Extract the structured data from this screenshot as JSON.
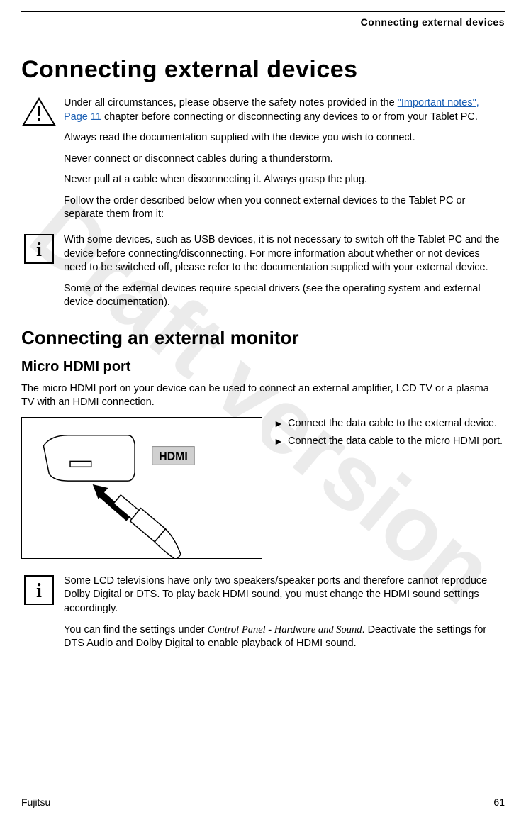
{
  "watermark": "Draft version",
  "header": {
    "running_title": "Connecting external devices"
  },
  "h1": "Connecting external devices",
  "warning": {
    "p1_prefix": "Under all circumstances, please observe the safety notes provided in the ",
    "link_text": "\"Important notes\", Page 11 ",
    "p1_suffix": "chapter before connecting or disconnecting any devices to or from your Tablet PC.",
    "p2": "Always read the documentation supplied with the device you wish to connect.",
    "p3": "Never connect or disconnect cables during a thunderstorm.",
    "p4": "Never pull at a cable when disconnecting it. Always grasp the plug.",
    "p5": "Follow the order described below when you connect external devices to the Tablet PC or separate them from it:"
  },
  "info1": {
    "p1": "With some devices, such as USB devices, it is not necessary to switch off the Tablet PC and the device before connecting/disconnecting. For more information about whether or not devices need to be switched off, please refer to the documentation supplied with your external device.",
    "p2": "Some of the external devices require special drivers (see the operating system and external device documentation)."
  },
  "h2": "Connecting an external monitor",
  "h3": "Micro HDMI port",
  "micro_hdmi_intro": "The micro HDMI port on your device can be used to connect an external amplifier, LCD TV or a plasma TV with an HDMI connection.",
  "figure_label": "HDMI",
  "steps": {
    "s1": "Connect the data cable to the external device.",
    "s2": "Connect the data cable to the micro HDMI port."
  },
  "info2": {
    "p1": "Some LCD televisions have only two speakers/speaker ports and therefore cannot reproduce Dolby Digital or DTS. To play back HDMI sound, you must change the HDMI sound settings accordingly.",
    "p2a": "You can find the settings under ",
    "p2italic": "Control Panel - Hardware and Sound",
    "p2b": ". Deactivate the settings for DTS Audio and Dolby Digital to enable playback of HDMI sound."
  },
  "footer": {
    "brand": "Fujitsu",
    "page": "61"
  }
}
